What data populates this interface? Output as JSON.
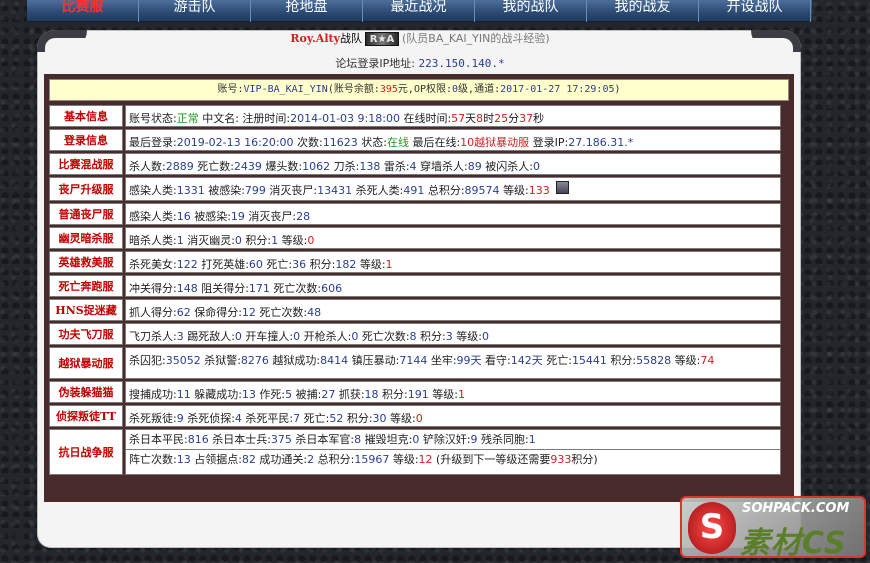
{
  "nav": {
    "items": [
      "比赛服",
      "游击队",
      "抢地盘",
      "最近战况",
      "我的战队",
      "我的战友",
      "开设战队"
    ]
  },
  "header": {
    "player_name": "Roy.Alty",
    "team_suffix": "战队",
    "team_badge": "R★A",
    "note": "(队员BA_KAI_YIN的战斗经验)"
  },
  "ip_line": {
    "label": "论坛登录IP地址:",
    "value": "223.150.140.*"
  },
  "account": {
    "t1": "账号:",
    "account_id": "VIP-BA_KAI_YIN",
    "t2": "(账号余额:",
    "balance": "395",
    "t3": "元,OP权限:",
    "op_level": "0",
    "t4": "级,通道:",
    "time": "2017-01-27 17:29:05",
    "t5": ")"
  },
  "rows": [
    {
      "label": "基本信息",
      "lines": [
        [
          {
            "t": "账号状态:"
          },
          {
            "t": "正常",
            "c": "green"
          },
          {
            "t": " 中文名:  注册时间:"
          },
          {
            "t": "2014-01-03 9:18:00",
            "c": "blue"
          },
          {
            "t": " 在线时间:"
          },
          {
            "t": "57",
            "c": "red"
          },
          {
            "t": "天"
          },
          {
            "t": "8",
            "c": "red"
          },
          {
            "t": "时"
          },
          {
            "t": "25",
            "c": "red"
          },
          {
            "t": "分"
          },
          {
            "t": "37",
            "c": "red"
          },
          {
            "t": "秒"
          }
        ]
      ]
    },
    {
      "label": "登录信息",
      "lines": [
        [
          {
            "t": "最后登录:"
          },
          {
            "t": "2019-02-13 16:20:00",
            "c": "blue"
          },
          {
            "t": " 次数:"
          },
          {
            "t": "11623",
            "c": "blue"
          },
          {
            "t": " 状态:"
          },
          {
            "t": "在线",
            "c": "green"
          },
          {
            "t": " 最后在线:"
          },
          {
            "t": "10越狱暴动服",
            "c": "red"
          },
          {
            "t": " 登录IP:"
          },
          {
            "t": "27.186.31.*",
            "c": "blue"
          }
        ]
      ]
    },
    {
      "label": "比赛混战服",
      "lines": [
        [
          {
            "t": "杀人数:"
          },
          {
            "t": "2889",
            "c": "blue"
          },
          {
            "t": " 死亡数:"
          },
          {
            "t": "2439",
            "c": "blue"
          },
          {
            "t": " 爆头数:"
          },
          {
            "t": "1062",
            "c": "blue"
          },
          {
            "t": " 刀杀:"
          },
          {
            "t": "138",
            "c": "blue"
          },
          {
            "t": " 雷杀:"
          },
          {
            "t": "4",
            "c": "blue"
          },
          {
            "t": " 穿墙杀人:"
          },
          {
            "t": "89",
            "c": "blue"
          },
          {
            "t": " 被闪杀人:"
          },
          {
            "t": "0",
            "c": "blue"
          }
        ]
      ]
    },
    {
      "label": "丧尸升级服",
      "avatar": true,
      "lines": [
        [
          {
            "t": "感染人类:"
          },
          {
            "t": "1331",
            "c": "blue"
          },
          {
            "t": " 被感染:"
          },
          {
            "t": "799",
            "c": "blue"
          },
          {
            "t": " 消灭丧尸:"
          },
          {
            "t": "13431",
            "c": "blue"
          },
          {
            "t": " 杀死人类:"
          },
          {
            "t": "491",
            "c": "blue"
          },
          {
            "t": " 总积分:"
          },
          {
            "t": "89574",
            "c": "blue"
          },
          {
            "t": " 等级:"
          },
          {
            "t": "133",
            "c": "red"
          }
        ]
      ]
    },
    {
      "label": "普通丧尸服",
      "lines": [
        [
          {
            "t": "感染人类:"
          },
          {
            "t": "16",
            "c": "blue"
          },
          {
            "t": " 被感染:"
          },
          {
            "t": "19",
            "c": "blue"
          },
          {
            "t": " 消灭丧尸:"
          },
          {
            "t": "28",
            "c": "blue"
          }
        ]
      ]
    },
    {
      "label": "幽灵暗杀服",
      "lines": [
        [
          {
            "t": "暗杀人类:"
          },
          {
            "t": "1",
            "c": "blue"
          },
          {
            "t": " 消灭幽灵:"
          },
          {
            "t": "0",
            "c": "blue"
          },
          {
            "t": " 积分:"
          },
          {
            "t": "1",
            "c": "blue"
          },
          {
            "t": " 等级:"
          },
          {
            "t": "0",
            "c": "red"
          }
        ]
      ]
    },
    {
      "label": "英雄救美服",
      "lines": [
        [
          {
            "t": "杀死美女:"
          },
          {
            "t": "122",
            "c": "blue"
          },
          {
            "t": " 打死英雄:"
          },
          {
            "t": "60",
            "c": "blue"
          },
          {
            "t": " 死亡:"
          },
          {
            "t": "36",
            "c": "blue"
          },
          {
            "t": " 积分:"
          },
          {
            "t": "182",
            "c": "blue"
          },
          {
            "t": " 等级:"
          },
          {
            "t": "1",
            "c": "red"
          }
        ]
      ]
    },
    {
      "label": "死亡奔跑服",
      "lines": [
        [
          {
            "t": "冲关得分:"
          },
          {
            "t": "148",
            "c": "blue"
          },
          {
            "t": " 阻关得分:"
          },
          {
            "t": "171",
            "c": "blue"
          },
          {
            "t": " 死亡次数:"
          },
          {
            "t": "606",
            "c": "blue"
          }
        ]
      ]
    },
    {
      "label": "HNS捉迷藏",
      "lines": [
        [
          {
            "t": "抓人得分:"
          },
          {
            "t": "62",
            "c": "blue"
          },
          {
            "t": " 保命得分:"
          },
          {
            "t": "12",
            "c": "blue"
          },
          {
            "t": " 死亡次数:"
          },
          {
            "t": "48",
            "c": "blue"
          }
        ]
      ]
    },
    {
      "label": "功夫飞刀服",
      "lines": [
        [
          {
            "t": "飞刀杀人:"
          },
          {
            "t": "3",
            "c": "blue"
          },
          {
            "t": " 踢死敌人:"
          },
          {
            "t": "0",
            "c": "blue"
          },
          {
            "t": " 开车撞人:"
          },
          {
            "t": "0",
            "c": "blue"
          },
          {
            "t": " 开枪杀人:"
          },
          {
            "t": "0",
            "c": "blue"
          },
          {
            "t": " 死亡次数:"
          },
          {
            "t": "8",
            "c": "blue"
          },
          {
            "t": " 积分:"
          },
          {
            "t": "3",
            "c": "blue"
          },
          {
            "t": " 等级:"
          },
          {
            "t": "0",
            "c": "blue"
          }
        ]
      ]
    },
    {
      "label": "越狱暴动服",
      "lines": [
        [
          {
            "t": "杀囚犯:"
          },
          {
            "t": "35052",
            "c": "blue"
          },
          {
            "t": " 杀狱警:"
          },
          {
            "t": "8276",
            "c": "blue"
          },
          {
            "t": " 越狱成功:"
          },
          {
            "t": "8414",
            "c": "blue"
          },
          {
            "t": " 镇压暴动:"
          },
          {
            "t": "7144",
            "c": "blue"
          },
          {
            "t": " 坐牢:"
          },
          {
            "t": "99天",
            "c": "blue"
          },
          {
            "t": " 看守:"
          },
          {
            "t": "142天",
            "c": "blue"
          },
          {
            "t": " 死亡:"
          },
          {
            "t": "15441",
            "c": "blue"
          },
          {
            "t": " 积分:"
          },
          {
            "t": "55828",
            "c": "blue"
          },
          {
            "t": " 等级:"
          },
          {
            "t": "74",
            "c": "red"
          }
        ]
      ]
    },
    {
      "label": "伪装躲猫猫",
      "lines": [
        [
          {
            "t": "搜捕成功:"
          },
          {
            "t": "11",
            "c": "blue"
          },
          {
            "t": " 躲藏成功:"
          },
          {
            "t": "13",
            "c": "blue"
          },
          {
            "t": " 作死:"
          },
          {
            "t": "5",
            "c": "blue"
          },
          {
            "t": " 被捕:"
          },
          {
            "t": "27",
            "c": "blue"
          },
          {
            "t": " 抓获:"
          },
          {
            "t": "18",
            "c": "blue"
          },
          {
            "t": " 积分:"
          },
          {
            "t": "191",
            "c": "blue"
          },
          {
            "t": " 等级:"
          },
          {
            "t": "1",
            "c": "red"
          }
        ]
      ]
    },
    {
      "label": "侦探叛徒TT",
      "lines": [
        [
          {
            "t": "杀死叛徒:"
          },
          {
            "t": "9",
            "c": "blue"
          },
          {
            "t": " 杀死侦探:"
          },
          {
            "t": "4",
            "c": "blue"
          },
          {
            "t": " 杀死平民:"
          },
          {
            "t": "7",
            "c": "blue"
          },
          {
            "t": " 死亡:"
          },
          {
            "t": "52",
            "c": "blue"
          },
          {
            "t": " 积分:"
          },
          {
            "t": "30",
            "c": "blue"
          },
          {
            "t": " 等级:"
          },
          {
            "t": "0",
            "c": "red"
          }
        ]
      ]
    },
    {
      "label": "抗日战争服",
      "lines": [
        [
          {
            "t": "杀日本平民:"
          },
          {
            "t": "816",
            "c": "blue"
          },
          {
            "t": " 杀日本士兵:"
          },
          {
            "t": "375",
            "c": "blue"
          },
          {
            "t": " 杀日本军官:"
          },
          {
            "t": "8",
            "c": "blue"
          },
          {
            "t": " 摧毁坦克:"
          },
          {
            "t": "0",
            "c": "blue"
          },
          {
            "t": " 铲除汉奸:"
          },
          {
            "t": "9",
            "c": "blue"
          },
          {
            "t": " 残杀同胞:"
          },
          {
            "t": "1",
            "c": "blue"
          }
        ],
        [
          {
            "t": "阵亡次数:"
          },
          {
            "t": "13",
            "c": "blue"
          },
          {
            "t": " 占领据点:"
          },
          {
            "t": "82",
            "c": "blue"
          },
          {
            "t": " 成功通关:"
          },
          {
            "t": "2",
            "c": "blue"
          },
          {
            "t": " 总积分:"
          },
          {
            "t": "15967",
            "c": "blue"
          },
          {
            "t": " 等级:"
          },
          {
            "t": "12",
            "c": "red"
          },
          {
            "t": " (升级到下一等级还需要"
          },
          {
            "t": "933",
            "c": "red"
          },
          {
            "t": "积分)"
          }
        ]
      ]
    }
  ],
  "watermark": {
    "top": "SOHPACK.COM",
    "main": "素材CS",
    "mark": "S"
  },
  "colors": {
    "label_red": "#c00000",
    "value_blue": "#2c3e90",
    "value_red": "#cc2222",
    "value_green": "#1f9a1f",
    "account_bg": "#ffffcc",
    "frame": "#4a2b2b"
  }
}
